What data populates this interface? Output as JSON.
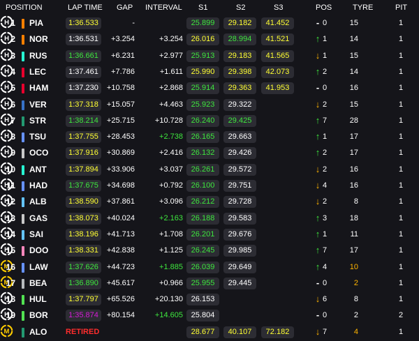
{
  "header": {
    "position": "POSITION",
    "lap_time": "LAP TIME",
    "gap": "GAP",
    "interval": "INTERVAL",
    "s1": "S1",
    "s2": "S2",
    "s3": "S3",
    "pos": "POS",
    "tyre": "TYRE",
    "pit": "PIT"
  },
  "colors": {
    "background": "#15151a",
    "fastest_overall": "#d61bd6",
    "personal_best": "#3ee63e",
    "normal": "#ffff33",
    "up_arrow": "#3ee63e",
    "down_arrow": "#ffb400",
    "retired": "#ff2d2d"
  },
  "rows": [
    {
      "pos": "1",
      "team_color": "#ff8000",
      "driver": "PIA",
      "lap": "1:36.533",
      "lap_color": "yellow",
      "gap": "-",
      "interval": "",
      "interval_color": "white",
      "s1": "25.899",
      "s1_color": "green",
      "s2": "29.182",
      "s2_color": "yellow",
      "s3": "41.452",
      "s3_color": "yellow",
      "arrow": "-",
      "arrow_color": "white",
      "change": "0",
      "age": "15",
      "tyre": "H",
      "tyre_color": "#ffffff",
      "pit": "1"
    },
    {
      "pos": "2",
      "team_color": "#ff8000",
      "driver": "NOR",
      "lap": "1:36.531",
      "lap_color": "white",
      "gap": "+3.254",
      "interval": "+3.254",
      "interval_color": "white",
      "s1": "26.016",
      "s1_color": "yellow",
      "s2": "28.994",
      "s2_color": "green",
      "s3": "41.521",
      "s3_color": "yellow",
      "arrow": "↑",
      "arrow_color": "green",
      "change": "1",
      "age": "14",
      "tyre": "H",
      "tyre_color": "#ffffff",
      "pit": "1"
    },
    {
      "pos": "3",
      "team_color": "#27f4d2",
      "driver": "RUS",
      "lap": "1:36.661",
      "lap_color": "green",
      "gap": "+6.231",
      "interval": "+2.977",
      "interval_color": "white",
      "s1": "25.913",
      "s1_color": "green",
      "s2": "29.183",
      "s2_color": "yellow",
      "s3": "41.565",
      "s3_color": "yellow",
      "arrow": "↓",
      "arrow_color": "orange",
      "change": "1",
      "age": "15",
      "tyre": "H",
      "tyre_color": "#ffffff",
      "pit": "1"
    },
    {
      "pos": "4",
      "team_color": "#e8002d",
      "driver": "LEC",
      "lap": "1:37.461",
      "lap_color": "white",
      "gap": "+7.786",
      "interval": "+1.611",
      "interval_color": "white",
      "s1": "25.990",
      "s1_color": "yellow",
      "s2": "29.398",
      "s2_color": "yellow",
      "s3": "42.073",
      "s3_color": "yellow",
      "arrow": "↑",
      "arrow_color": "green",
      "change": "2",
      "age": "14",
      "tyre": "H",
      "tyre_color": "#ffffff",
      "pit": "1"
    },
    {
      "pos": "5",
      "team_color": "#e8002d",
      "driver": "HAM",
      "lap": "1:37.230",
      "lap_color": "white",
      "gap": "+10.758",
      "interval": "+2.868",
      "interval_color": "white",
      "s1": "25.914",
      "s1_color": "green",
      "s2": "29.363",
      "s2_color": "yellow",
      "s3": "41.953",
      "s3_color": "yellow",
      "arrow": "-",
      "arrow_color": "white",
      "change": "0",
      "age": "16",
      "tyre": "H",
      "tyre_color": "#ffffff",
      "pit": "1"
    },
    {
      "pos": "6",
      "team_color": "#3671c6",
      "driver": "VER",
      "lap": "1:37.318",
      "lap_color": "yellow",
      "gap": "+15.057",
      "interval": "+4.463",
      "interval_color": "white",
      "s1": "25.923",
      "s1_color": "green",
      "s2": "29.322",
      "s2_color": "white",
      "s3": "",
      "s3_color": "white",
      "arrow": "↓",
      "arrow_color": "orange",
      "change": "2",
      "age": "15",
      "tyre": "H",
      "tyre_color": "#ffffff",
      "pit": "1"
    },
    {
      "pos": "7",
      "team_color": "#229971",
      "driver": "STR",
      "lap": "1:38.214",
      "lap_color": "green",
      "gap": "+25.715",
      "interval": "+10.728",
      "interval_color": "white",
      "s1": "26.240",
      "s1_color": "green",
      "s2": "29.425",
      "s2_color": "green",
      "s3": "",
      "s3_color": "white",
      "arrow": "↑",
      "arrow_color": "green",
      "change": "7",
      "age": "28",
      "tyre": "H",
      "tyre_color": "#ffffff",
      "pit": "1"
    },
    {
      "pos": "8",
      "team_color": "#6692ff",
      "driver": "TSU",
      "lap": "1:37.755",
      "lap_color": "yellow",
      "gap": "+28.453",
      "interval": "+2.738",
      "interval_color": "green",
      "s1": "26.165",
      "s1_color": "green",
      "s2": "29.663",
      "s2_color": "white",
      "s3": "",
      "s3_color": "white",
      "arrow": "↑",
      "arrow_color": "green",
      "change": "1",
      "age": "17",
      "tyre": "H",
      "tyre_color": "#ffffff",
      "pit": "1"
    },
    {
      "pos": "9",
      "team_color": "#c8c8c8",
      "driver": "OCO",
      "lap": "1:37.916",
      "lap_color": "yellow",
      "gap": "+30.869",
      "interval": "+2.416",
      "interval_color": "white",
      "s1": "26.132",
      "s1_color": "green",
      "s2": "29.426",
      "s2_color": "white",
      "s3": "",
      "s3_color": "white",
      "arrow": "↑",
      "arrow_color": "green",
      "change": "2",
      "age": "17",
      "tyre": "H",
      "tyre_color": "#ffffff",
      "pit": "1"
    },
    {
      "pos": "10",
      "team_color": "#27f4d2",
      "driver": "ANT",
      "lap": "1:37.894",
      "lap_color": "yellow",
      "gap": "+33.906",
      "interval": "+3.037",
      "interval_color": "white",
      "s1": "26.261",
      "s1_color": "green",
      "s2": "29.572",
      "s2_color": "white",
      "s3": "",
      "s3_color": "white",
      "arrow": "↓",
      "arrow_color": "orange",
      "change": "2",
      "age": "16",
      "tyre": "H",
      "tyre_color": "#ffffff",
      "pit": "1"
    },
    {
      "pos": "11",
      "team_color": "#6692ff",
      "driver": "HAD",
      "lap": "1:37.675",
      "lap_color": "green",
      "gap": "+34.698",
      "interval": "+0.792",
      "interval_color": "white",
      "s1": "26.100",
      "s1_color": "green",
      "s2": "29.751",
      "s2_color": "white",
      "s3": "",
      "s3_color": "white",
      "arrow": "↓",
      "arrow_color": "orange",
      "change": "4",
      "age": "16",
      "tyre": "H",
      "tyre_color": "#ffffff",
      "pit": "1"
    },
    {
      "pos": "12",
      "team_color": "#64c4ff",
      "driver": "ALB",
      "lap": "1:38.590",
      "lap_color": "yellow",
      "gap": "+37.861",
      "interval": "+3.096",
      "interval_color": "white",
      "s1": "26.212",
      "s1_color": "green",
      "s2": "29.728",
      "s2_color": "white",
      "s3": "",
      "s3_color": "white",
      "arrow": "↓",
      "arrow_color": "orange",
      "change": "2",
      "age": "8",
      "tyre": "H",
      "tyre_color": "#ffffff",
      "pit": "1"
    },
    {
      "pos": "13",
      "team_color": "#c8c8c8",
      "driver": "GAS",
      "lap": "1:38.073",
      "lap_color": "yellow",
      "gap": "+40.024",
      "interval": "+2.163",
      "interval_color": "green",
      "s1": "26.188",
      "s1_color": "green",
      "s2": "29.583",
      "s2_color": "white",
      "s3": "",
      "s3_color": "white",
      "arrow": "↑",
      "arrow_color": "green",
      "change": "3",
      "age": "18",
      "tyre": "H",
      "tyre_color": "#ffffff",
      "pit": "1"
    },
    {
      "pos": "14",
      "team_color": "#64c4ff",
      "driver": "SAI",
      "lap": "1:38.196",
      "lap_color": "yellow",
      "gap": "+41.713",
      "interval": "+1.708",
      "interval_color": "white",
      "s1": "26.201",
      "s1_color": "green",
      "s2": "29.676",
      "s2_color": "white",
      "s3": "",
      "s3_color": "white",
      "arrow": "↑",
      "arrow_color": "green",
      "change": "1",
      "age": "11",
      "tyre": "H",
      "tyre_color": "#ffffff",
      "pit": "1"
    },
    {
      "pos": "15",
      "team_color": "#ff87bc",
      "driver": "DOO",
      "lap": "1:38.331",
      "lap_color": "yellow",
      "gap": "+42.838",
      "interval": "+1.125",
      "interval_color": "white",
      "s1": "26.245",
      "s1_color": "green",
      "s2": "29.985",
      "s2_color": "white",
      "s3": "",
      "s3_color": "white",
      "arrow": "↑",
      "arrow_color": "green",
      "change": "7",
      "age": "17",
      "tyre": "H",
      "tyre_color": "#ffffff",
      "pit": "1"
    },
    {
      "pos": "16",
      "team_color": "#6692ff",
      "driver": "LAW",
      "lap": "1:37.626",
      "lap_color": "green",
      "gap": "+44.723",
      "interval": "+1.885",
      "interval_color": "green",
      "s1": "26.039",
      "s1_color": "green",
      "s2": "29.649",
      "s2_color": "white",
      "s3": "",
      "s3_color": "white",
      "arrow": "↑",
      "arrow_color": "green",
      "change": "4",
      "age": "10",
      "tyre": "M",
      "tyre_color": "#ffcc00",
      "pit": "1"
    },
    {
      "pos": "17",
      "team_color": "#b6babd",
      "driver": "BEA",
      "lap": "1:36.890",
      "lap_color": "green",
      "gap": "+45.617",
      "interval": "+0.966",
      "interval_color": "white",
      "s1": "25.955",
      "s1_color": "green",
      "s2": "29.445",
      "s2_color": "white",
      "s3": "",
      "s3_color": "white",
      "arrow": "-",
      "arrow_color": "white",
      "change": "0",
      "age": "2",
      "tyre": "M",
      "tyre_color": "#ffcc00",
      "pit": "1"
    },
    {
      "pos": "18",
      "team_color": "#52e252",
      "driver": "HUL",
      "lap": "1:37.797",
      "lap_color": "yellow",
      "gap": "+65.526",
      "interval": "+20.130",
      "interval_color": "white",
      "s1": "26.153",
      "s1_color": "white",
      "s2": "",
      "s2_color": "white",
      "s3": "",
      "s3_color": "white",
      "arrow": "↓",
      "arrow_color": "orange",
      "change": "6",
      "age": "8",
      "tyre": "H",
      "tyre_color": "#ffffff",
      "pit": "1"
    },
    {
      "pos": "19",
      "team_color": "#52e252",
      "driver": "BOR",
      "lap": "1:35.874",
      "lap_color": "purple",
      "gap": "+80.154",
      "interval": "+14.605",
      "interval_color": "green",
      "s1": "25.804",
      "s1_color": "white",
      "s2": "",
      "s2_color": "white",
      "s3": "",
      "s3_color": "white",
      "arrow": "-",
      "arrow_color": "white",
      "change": "0",
      "age": "2",
      "tyre": "H",
      "tyre_color": "#ffffff",
      "pit": "2"
    },
    {
      "pos": "",
      "team_color": "#229971",
      "driver": "ALO",
      "lap": "",
      "lap_color": "white",
      "retired": "RETIRED",
      "gap": "",
      "interval": "",
      "interval_color": "white",
      "s1": "28.677",
      "s1_color": "yellow",
      "s2": "40.107",
      "s2_color": "yellow",
      "s3": "72.182",
      "s3_color": "yellow",
      "arrow": "↓",
      "arrow_color": "orange",
      "change": "7",
      "age": "4",
      "tyre": "M",
      "tyre_color": "#ffcc00",
      "pit": "1"
    }
  ]
}
